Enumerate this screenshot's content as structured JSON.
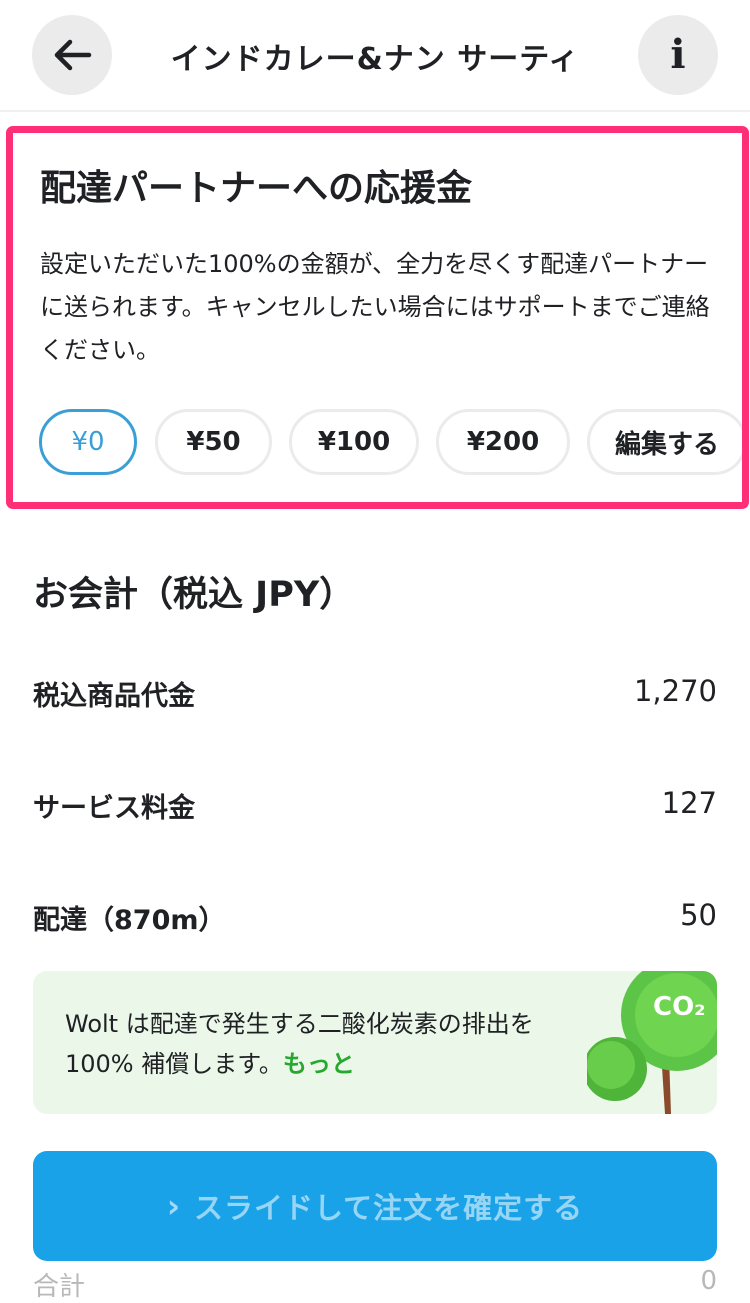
{
  "header": {
    "title": "インドカレー&ナン サーティ",
    "back_icon": "arrow-left-icon",
    "info_icon": "info-icon"
  },
  "tip": {
    "title": "配達パートナーへの応援金",
    "description": "設定いただいた100%の金額が、全力を尽くす配達パートナーに送られます。キャンセルしたい場合にはサポートまでご連絡ください。",
    "options": [
      "¥0",
      "¥50",
      "¥100",
      "¥200",
      "編集する"
    ],
    "selected_index": 0
  },
  "checkout": {
    "title": "お会計（税込 JPY）",
    "lines": [
      {
        "label": "税込商品代金",
        "value": "1,270"
      },
      {
        "label": "サービス料金",
        "value": "127"
      },
      {
        "label": "配達（870m）",
        "value": "50"
      }
    ]
  },
  "co2": {
    "text": "Wolt は配達で発生する二酸化炭素の排出を100% 補償します。",
    "more": "もっと",
    "badge": "CO₂"
  },
  "slide_button": {
    "label": "スライドして注文を確定する",
    "icon": "chevron-right-icon"
  },
  "total": {
    "label": "合計",
    "value": "0"
  },
  "colors": {
    "highlight": "#fe2f77",
    "accent": "#3a9fd6",
    "button": "#1aa2e8",
    "green": "#26a82e"
  }
}
